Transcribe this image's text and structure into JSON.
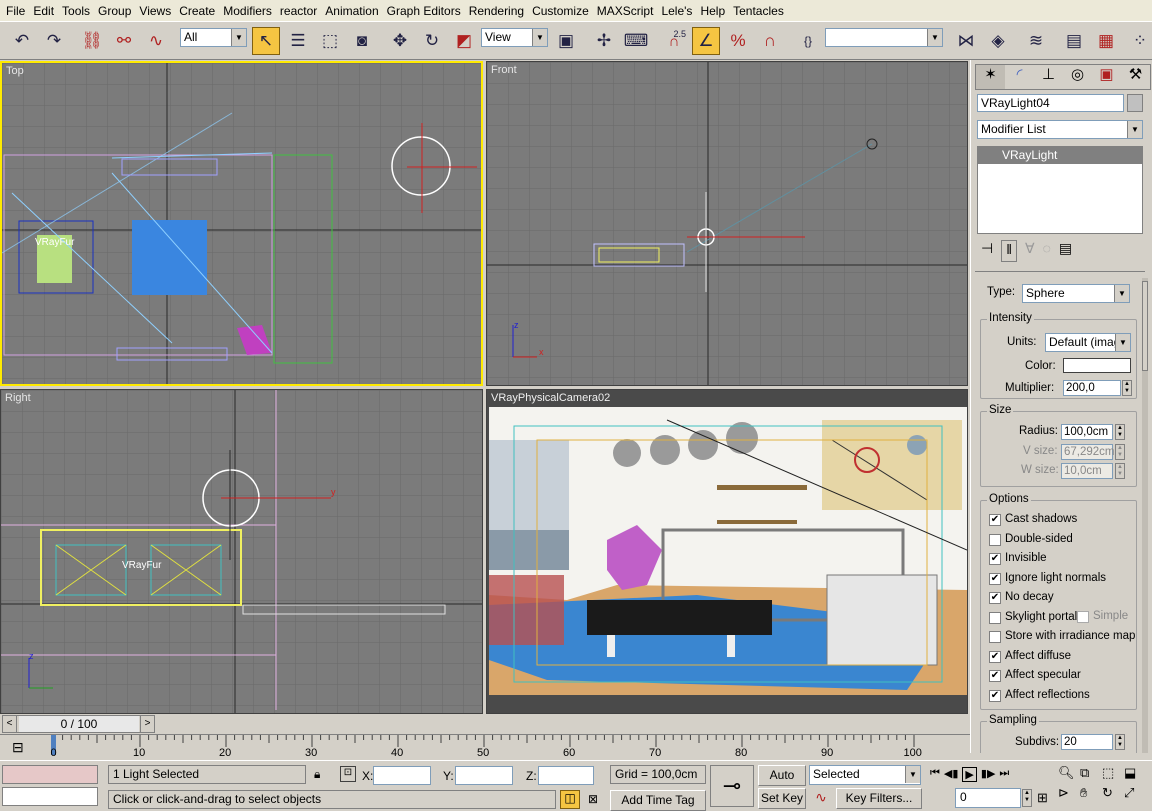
{
  "menu": [
    "File",
    "Edit",
    "Tools",
    "Group",
    "Views",
    "Create",
    "Modifiers",
    "reactor",
    "Animation",
    "Graph Editors",
    "Rendering",
    "Customize",
    "MAXScript",
    "Lele's",
    "Help",
    "Tentacles"
  ],
  "toolbar": {
    "selection_filter": "All",
    "ref_coord": "View",
    "snap_label": "2.5",
    "named_selection": "",
    "icons": [
      "undo-icon",
      "redo-icon",
      "select-link-icon",
      "unlink-icon",
      "bind-spacewarp-icon",
      "select-object-icon",
      "select-by-name-icon",
      "rect-region-icon",
      "window-crossing-icon",
      "move-icon",
      "rotate-icon",
      "scale-icon",
      "pivot-icon",
      "manipulate-icon",
      "keyboard-shortcut-icon",
      "snap-icon",
      "angle-snap-icon",
      "percent-snap-icon",
      "spinner-snap-icon",
      "edit-named-sel-icon",
      "mirror-icon",
      "align-icon",
      "layer-manager-icon",
      "curve-editor-icon",
      "schematic-icon",
      "material-editor-icon"
    ]
  },
  "viewports": {
    "top": "Top",
    "front": "Front",
    "right": "Right",
    "camera": "VRayPhysicalCamera02",
    "obj_label": "VRayFur"
  },
  "axis": {
    "x": "x",
    "y": "y",
    "z": "z"
  },
  "command_panel": {
    "object_name": "VRayLight04",
    "modifier_list": "Modifier List",
    "stack_item": "VRayLight",
    "type_label": "Type:",
    "type_value": "Sphere",
    "intensity": {
      "title": "Intensity",
      "units_label": "Units:",
      "units_value": "Default (image)",
      "color_label": "Color:",
      "color_value": "#ffffff",
      "multiplier_label": "Multiplier:",
      "multiplier_value": "200,0"
    },
    "size": {
      "title": "Size",
      "radius_label": "Radius:",
      "radius_value": "100,0cm",
      "vsize_label": "V size:",
      "vsize_value": "67,292cm",
      "wsize_label": "W size:",
      "wsize_value": "10,0cm"
    },
    "options": {
      "title": "Options",
      "items": [
        {
          "label": "Cast shadows",
          "checked": true
        },
        {
          "label": "Double-sided",
          "checked": false
        },
        {
          "label": "Invisible",
          "checked": true
        },
        {
          "label": "Ignore light normals",
          "checked": true
        },
        {
          "label": "No decay",
          "checked": true
        },
        {
          "label": "Skylight portal",
          "checked": false
        },
        {
          "label": "Store with irradiance map",
          "checked": false
        },
        {
          "label": "Affect diffuse",
          "checked": true
        },
        {
          "label": "Affect specular",
          "checked": true
        },
        {
          "label": "Affect reflections",
          "checked": true
        }
      ],
      "simple_label": "Simple",
      "simple_checked": false
    },
    "sampling": {
      "title": "Sampling",
      "subdivs_label": "Subdivs:",
      "subdivs_value": "20"
    }
  },
  "timeline": {
    "frame_display": "0 / 100",
    "ruler_labels": [
      "0",
      "10",
      "20",
      "30",
      "40",
      "50",
      "60",
      "70",
      "80",
      "90",
      "100"
    ]
  },
  "status": {
    "selection": "1 Light Selected",
    "prompt": "Click or click-and-drag to select objects",
    "x_label": "X:",
    "y_label": "Y:",
    "z_label": "Z:",
    "x_value": "",
    "y_value": "",
    "z_value": "",
    "grid": "Grid = 100,0cm",
    "add_time_tag": "Add Time Tag",
    "auto_key": "Auto Key",
    "set_key": "Set Key",
    "key_mode": "Selected",
    "key_filters": "Key Filters...",
    "current_frame": "0"
  }
}
